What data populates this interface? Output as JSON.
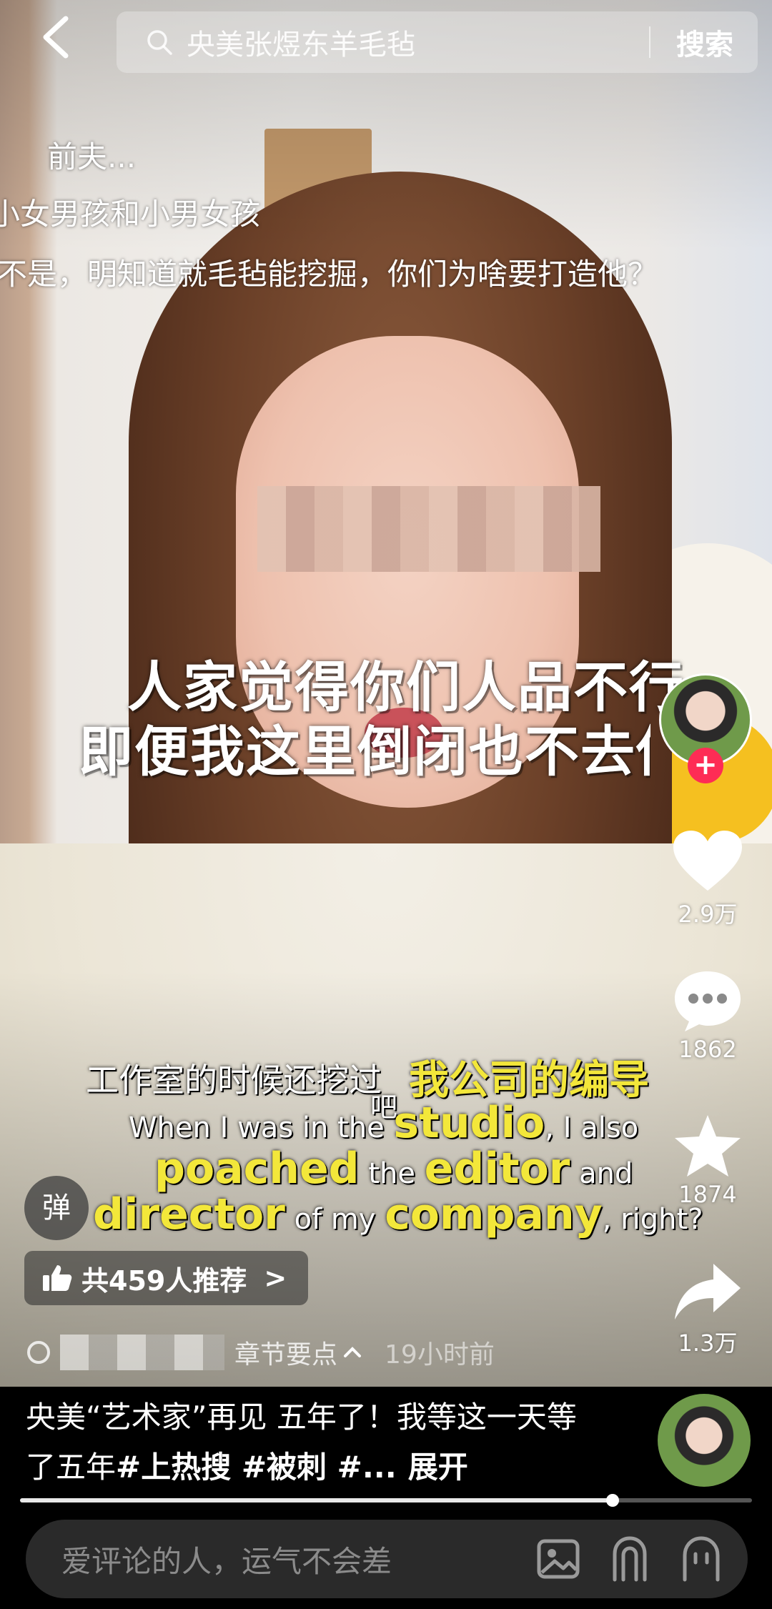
{
  "search": {
    "query": "央美张煜东羊毛毡",
    "button_label": "搜索"
  },
  "danmaku": [
    "前夫...",
    "小女男孩和小男女孩",
    "不是，明知道就毛毡能挖掘，你们为啥要打造他？"
  ],
  "caption": {
    "line1": "人家觉得你们人品不行",
    "line2": "即便我这里倒闭也不去你们"
  },
  "subtitle": {
    "cn_prefix": "工作室的时候还挖过",
    "cn_highlight": "我公司的编导",
    "cn_suffix": "吧",
    "en1_a": "When I was in the ",
    "en1_b": "studio",
    "en1_c": ", I also",
    "en2_a": "poached",
    "en2_b": " the ",
    "en2_c": "editor",
    "en2_d": " and",
    "en3_a": "director",
    "en3_b": " of my ",
    "en3_c": "company",
    "en3_d": ", right?"
  },
  "actions": {
    "like_count": "2.9万",
    "comment_count": "1862",
    "favorite_count": "1874",
    "share_count": "1.3万",
    "follow_symbol": "+"
  },
  "danmu_toggle": "弹",
  "recommend": {
    "label": "共459人推荐",
    "chevron": ">"
  },
  "meta": {
    "chapter": "章节要点",
    "time": "19小时前"
  },
  "post": {
    "title": "央美“艺术家”再见 五年了！我等这一天等了五年",
    "tags": "#上热搜 #被刺 #...",
    "expand": "展开"
  },
  "progress": {
    "played_fraction": 0.81
  },
  "comment": {
    "placeholder": "爱评论的人，运气不会差"
  },
  "colors": {
    "caption_yellow": "#f3e73a",
    "follow_red": "#fe2c55"
  }
}
